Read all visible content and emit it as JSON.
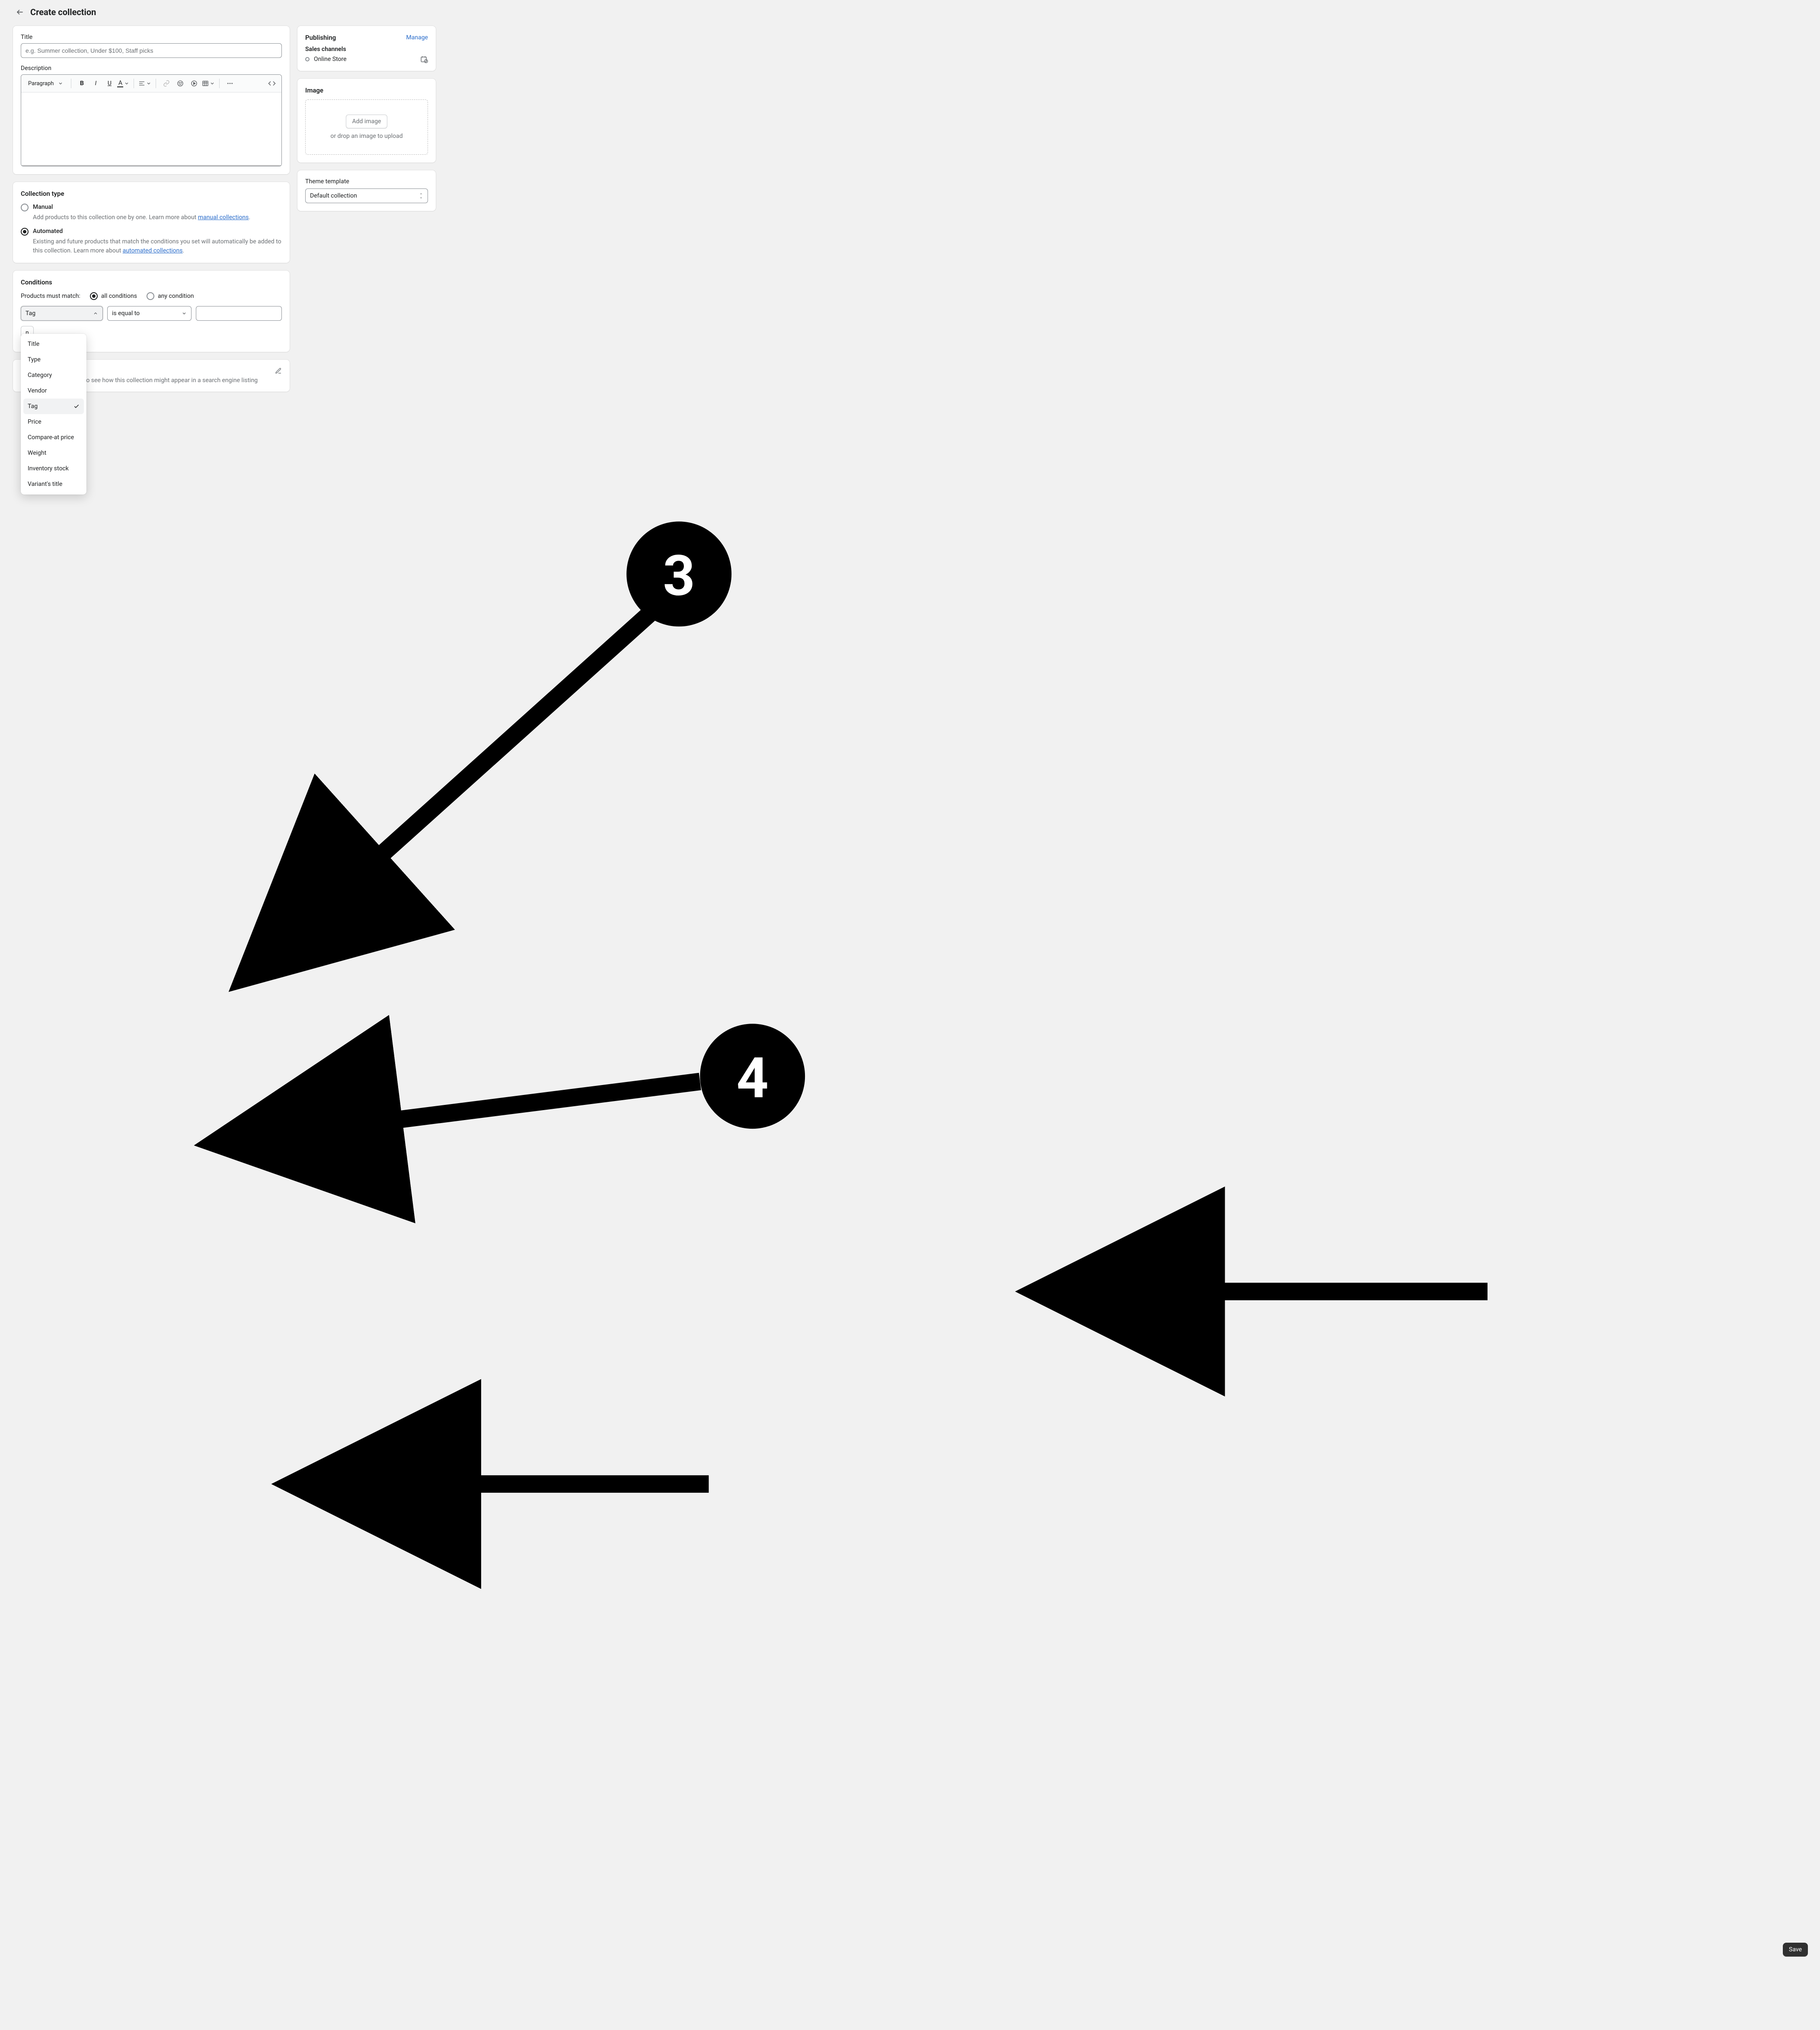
{
  "header": {
    "title": "Create collection"
  },
  "titleCard": {
    "label": "Title",
    "placeholder": "e.g. Summer collection, Under $100, Staff picks",
    "value": ""
  },
  "descriptionCard": {
    "label": "Description",
    "paragraphLabel": "Paragraph"
  },
  "collectionType": {
    "heading": "Collection type",
    "manual": {
      "label": "Manual",
      "help_prefix": "Add products to this collection one by one. Learn more about ",
      "help_link": "manual collections",
      "help_suffix": "."
    },
    "automated": {
      "label": "Automated",
      "help_prefix": "Existing and future products that match the conditions you set will automatically be added to this collection. Learn more about ",
      "help_link": "automated collections",
      "help_suffix": "."
    },
    "selected": "automated"
  },
  "conditions": {
    "heading": "Conditions",
    "matchLabel": "Products must match:",
    "allLabel": "all conditions",
    "anyLabel": "any condition",
    "matchSelected": "all",
    "rule": {
      "field": "Tag",
      "operator": "is equal to",
      "value": ""
    },
    "fieldOptions": [
      "Title",
      "Type",
      "Category",
      "Vendor",
      "Tag",
      "Price",
      "Compare-at price",
      "Weight",
      "Inventory stock",
      "Variant's title"
    ],
    "selectedFieldIndex": 4,
    "addAnotherLabel_visible_fragment": "n"
  },
  "searchListing": {
    "help": "to see how this collection might appear in a search engine listing"
  },
  "publishing": {
    "heading": "Publishing",
    "manage": "Manage",
    "salesChannelsLabel": "Sales channels",
    "channel": "Online Store"
  },
  "imageCard": {
    "heading": "Image",
    "addLabel": "Add image",
    "dropHint": "or drop an image to upload"
  },
  "themeCard": {
    "heading": "Theme template",
    "value": "Default collection"
  },
  "saveLabel": "Save",
  "badges": {
    "b3": "3",
    "b4": "4"
  }
}
